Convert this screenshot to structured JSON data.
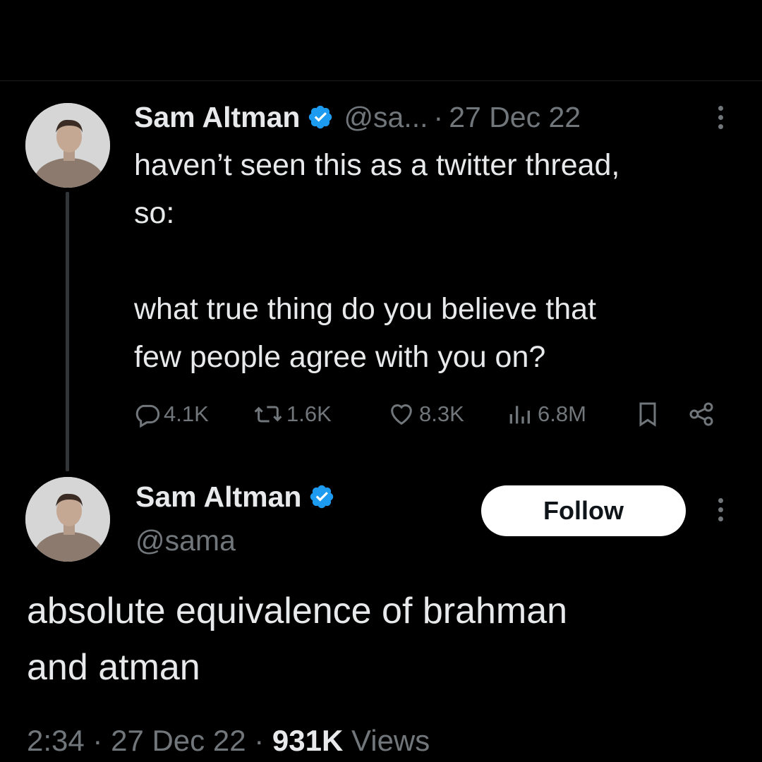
{
  "tweet": {
    "author_name": "Sam Altman",
    "handle": "@sa...",
    "separator": "·",
    "date": "27 Dec 22",
    "text_line_1": "haven’t seen this as a twitter thread,",
    "text_line_2": "so:",
    "text_line_3": "what true thing do you believe that",
    "text_line_4": "few people agree with you on?",
    "stats": {
      "replies": "4.1K",
      "reposts": "1.6K",
      "likes": "8.3K",
      "views": "6.8M"
    },
    "icons": [
      "verified-badge-icon",
      "more-icon",
      "reply-icon",
      "repost-icon",
      "like-icon",
      "views-icon",
      "bookmark-icon",
      "share-icon"
    ]
  },
  "reply": {
    "author_name": "Sam Altman",
    "handle": "@sama",
    "follow_label": "Follow",
    "text_line_1": "absolute equivalence of brahman",
    "text_line_2": "and atman",
    "footer": {
      "time": "2:34",
      "sep1": "·",
      "date": "27 Dec 22",
      "sep2": "·",
      "views_count": "931K",
      "views_label": "Views"
    }
  },
  "colors": {
    "background": "#000000",
    "text": "#e7e9ea",
    "muted": "#71767b",
    "verified": "#1d9bf0",
    "follow_bg": "#ffffff"
  }
}
